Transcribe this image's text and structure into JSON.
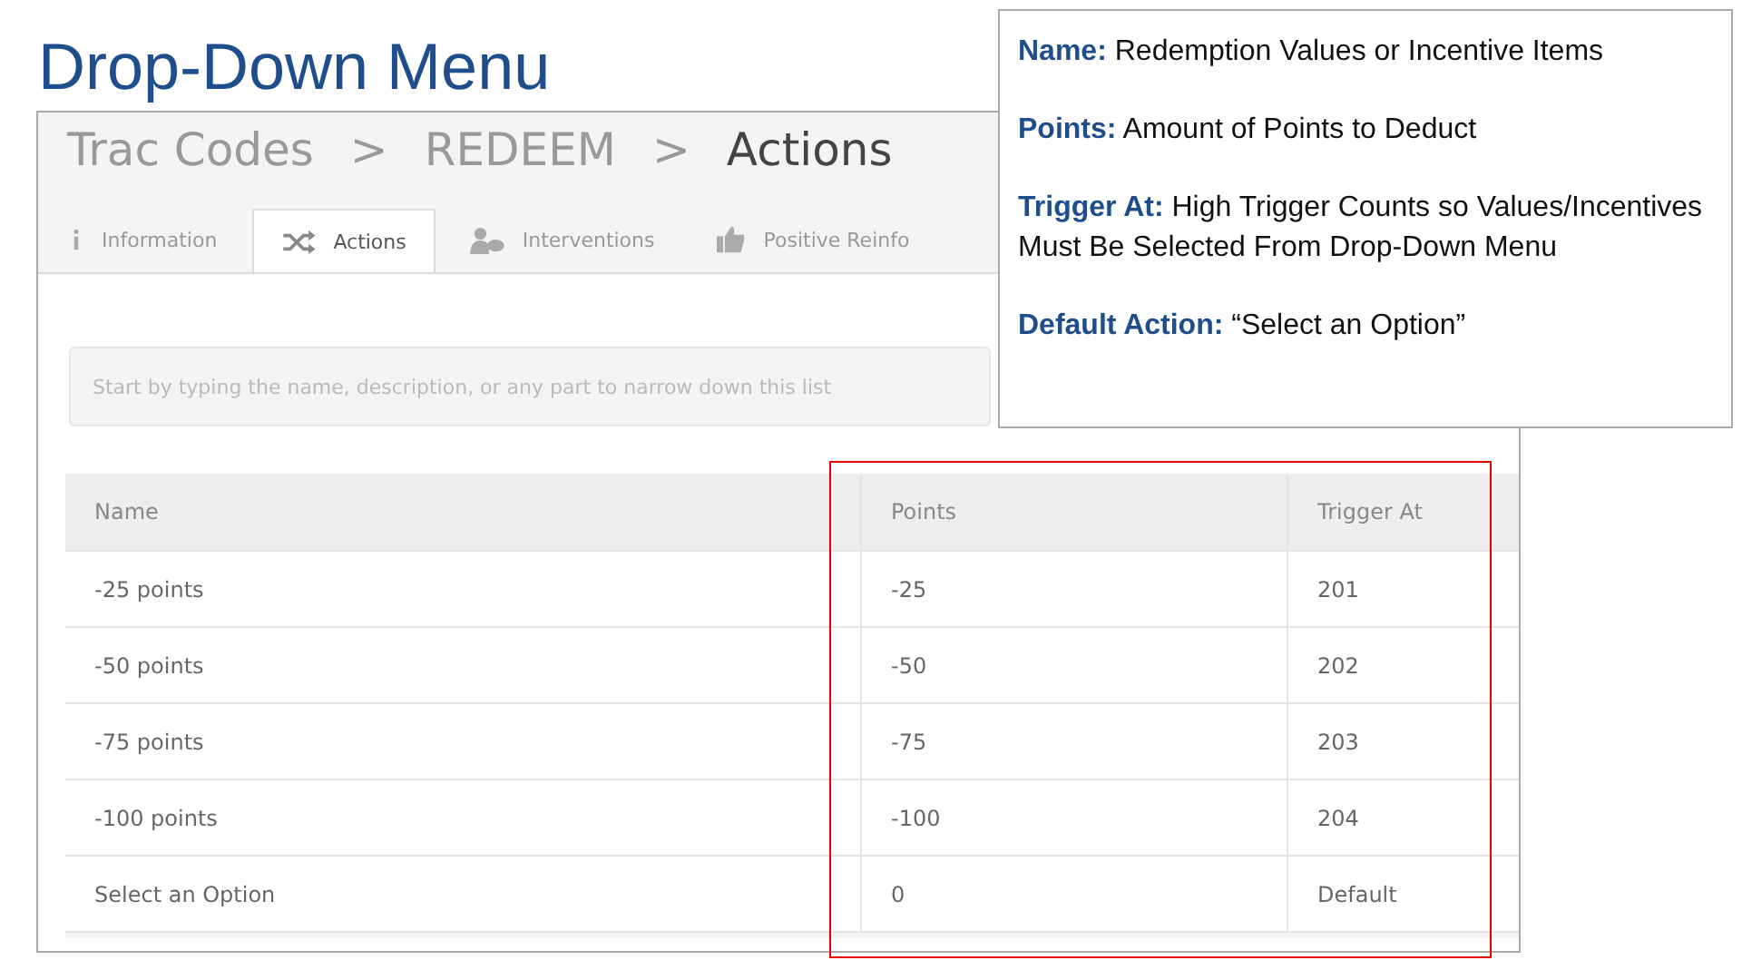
{
  "slide_title": "Drop-Down Menu",
  "app": {
    "breadcrumb": [
      {
        "label": "Trac Codes",
        "current": false
      },
      {
        "label": "REDEEM",
        "current": false
      },
      {
        "label": "Actions",
        "current": true
      }
    ],
    "breadcrumb_separators": [
      ">",
      ">"
    ],
    "tabs": [
      {
        "label": "Information",
        "selected": false
      },
      {
        "label": "Actions",
        "selected": true
      },
      {
        "label": "Interventions",
        "selected": false
      },
      {
        "label": "Positive Reinfo",
        "selected": false
      }
    ],
    "search": {
      "placeholder": "Start by typing the name, description, or any part to narrow down this list"
    },
    "table": {
      "columns": [
        "Name",
        "Points",
        "Trigger At"
      ],
      "rows": [
        [
          "-25 points",
          "-25",
          "201"
        ],
        [
          "-50 points",
          "-50",
          "202"
        ],
        [
          "-75 points",
          "-75",
          "203"
        ],
        [
          "-100 points",
          "-100",
          "204"
        ],
        [
          "Select an Option",
          "0",
          "Default"
        ]
      ]
    }
  },
  "callout": [
    {
      "term": "Name:",
      "text": "Redemption Values or Incentive Items"
    },
    {
      "term": "Points:",
      "text": "Amount of Points to Deduct"
    },
    {
      "term": "Trigger At:",
      "text": "High Trigger Counts so Values/Incentives Must Be Selected From Drop-Down Menu"
    },
    {
      "term": "Default Action:",
      "text": "“Select an Option”"
    }
  ]
}
